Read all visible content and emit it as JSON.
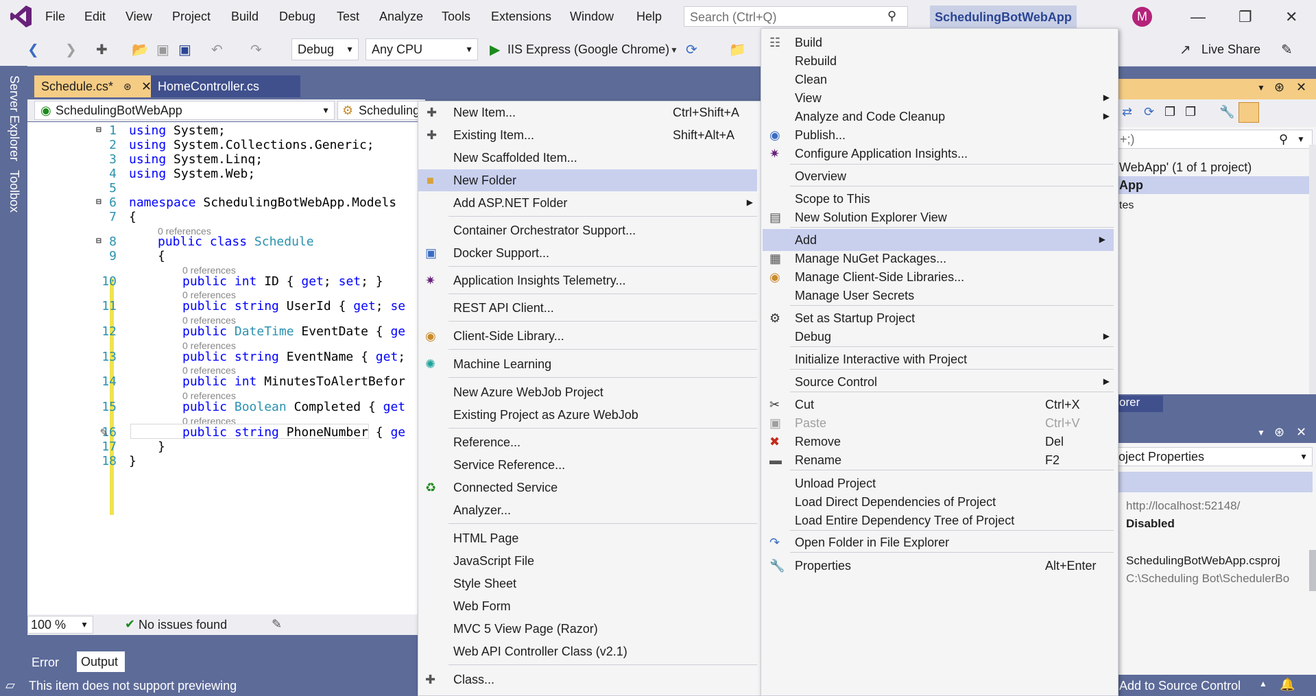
{
  "menubar": {
    "items": [
      "File",
      "Edit",
      "View",
      "Project",
      "Build",
      "Debug",
      "Test",
      "Analyze",
      "Tools",
      "Extensions",
      "Window",
      "Help"
    ],
    "search_placeholder": "Search (Ctrl+Q)",
    "solution_name": "SchedulingBotWebApp",
    "avatar_initial": "M"
  },
  "toolbar": {
    "config": "Debug",
    "platform": "Any CPU",
    "run_target": "IIS Express (Google Chrome)",
    "live_share": "Live Share"
  },
  "side": {
    "server_explorer": "Server Explorer",
    "toolbox": "Toolbox"
  },
  "editor": {
    "tabs": [
      {
        "label": "Schedule.cs*"
      },
      {
        "label": "HomeController.cs"
      }
    ],
    "nav_project": "SchedulingBotWebApp",
    "nav_class": "Scheduling",
    "line_numbers": [
      "1",
      "2",
      "3",
      "4",
      "5",
      "6",
      "7",
      "8",
      "9",
      "10",
      "11",
      "12",
      "13",
      "14",
      "15",
      "16",
      "17",
      "18"
    ],
    "ref_text": "0 references",
    "zoom": "100 %",
    "issues": "No issues found"
  },
  "bottom_tabs": [
    "Error List",
    "Output"
  ],
  "statusbar": {
    "message": "This item does not support previewing",
    "source_control": "Add to Source Control"
  },
  "right_panel": {
    "sol_title": "WebApp' (1 of 1 project)",
    "sol_project": "App",
    "sol_item": "tes",
    "explorer_tab": "orer",
    "prop_combo": "oject Properties",
    "prop_url": "http://localhost:52148/",
    "prop_ssl": "Disabled",
    "prop_file": "SchedulingBotWebApp.csproj",
    "prop_path": "C:\\Scheduling Bot\\SchedulerBo"
  },
  "add_menu": {
    "items": [
      {
        "label": "New Item...",
        "shortcut": "Ctrl+Shift+A",
        "icon": "new-item-icon"
      },
      {
        "label": "Existing Item...",
        "shortcut": "Shift+Alt+A",
        "icon": "existing-item-icon"
      },
      {
        "label": "New Scaffolded Item...",
        "shortcut": ""
      },
      {
        "label": "New Folder",
        "shortcut": "",
        "icon": "folder-icon"
      },
      {
        "label": "Add ASP.NET Folder",
        "shortcut": ""
      },
      {
        "label": "Container Orchestrator Support...",
        "shortcut": ""
      },
      {
        "label": "Docker Support...",
        "shortcut": "",
        "icon": "docker-icon"
      },
      {
        "label": "Application Insights Telemetry...",
        "shortcut": "",
        "icon": "insights-icon"
      },
      {
        "label": "REST API Client...",
        "shortcut": ""
      },
      {
        "label": "Client-Side Library...",
        "shortcut": "",
        "icon": "library-icon"
      },
      {
        "label": "Machine Learning",
        "shortcut": "",
        "icon": "ml-icon"
      },
      {
        "label": "New Azure WebJob Project",
        "shortcut": ""
      },
      {
        "label": "Existing Project as Azure WebJob",
        "shortcut": ""
      },
      {
        "label": "Reference...",
        "shortcut": ""
      },
      {
        "label": "Service Reference...",
        "shortcut": ""
      },
      {
        "label": "Connected Service",
        "shortcut": "",
        "icon": "connected-service-icon"
      },
      {
        "label": "Analyzer...",
        "shortcut": ""
      },
      {
        "label": "HTML Page",
        "shortcut": ""
      },
      {
        "label": "JavaScript File",
        "shortcut": ""
      },
      {
        "label": "Style Sheet",
        "shortcut": ""
      },
      {
        "label": "Web Form",
        "shortcut": ""
      },
      {
        "label": "MVC 5 View Page (Razor)",
        "shortcut": ""
      },
      {
        "label": "Web API Controller Class (v2.1)",
        "shortcut": ""
      },
      {
        "label": "Class...",
        "shortcut": "",
        "icon": "class-icon"
      }
    ]
  },
  "project_menu": {
    "items": [
      {
        "label": "Build",
        "shortcut": ""
      },
      {
        "label": "Rebuild",
        "shortcut": ""
      },
      {
        "label": "Clean",
        "shortcut": ""
      },
      {
        "label": "View",
        "shortcut": ""
      },
      {
        "label": "Analyze and Code Cleanup",
        "shortcut": ""
      },
      {
        "label": "Publish...",
        "shortcut": ""
      },
      {
        "label": "Configure Application Insights...",
        "shortcut": ""
      },
      {
        "label": "Overview",
        "shortcut": ""
      },
      {
        "label": "Scope to This",
        "shortcut": ""
      },
      {
        "label": "New Solution Explorer View",
        "shortcut": ""
      },
      {
        "label": "Add",
        "shortcut": ""
      },
      {
        "label": "Manage NuGet Packages...",
        "shortcut": ""
      },
      {
        "label": "Manage Client-Side Libraries...",
        "shortcut": ""
      },
      {
        "label": "Manage User Secrets",
        "shortcut": ""
      },
      {
        "label": "Set as Startup Project",
        "shortcut": ""
      },
      {
        "label": "Debug",
        "shortcut": ""
      },
      {
        "label": "Initialize Interactive with Project",
        "shortcut": ""
      },
      {
        "label": "Source Control",
        "shortcut": ""
      },
      {
        "label": "Cut",
        "shortcut": "Ctrl+X"
      },
      {
        "label": "Paste",
        "shortcut": "Ctrl+V"
      },
      {
        "label": "Remove",
        "shortcut": "Del"
      },
      {
        "label": "Rename",
        "shortcut": "F2"
      },
      {
        "label": "Unload Project",
        "shortcut": ""
      },
      {
        "label": "Load Direct Dependencies of Project",
        "shortcut": ""
      },
      {
        "label": "Load Entire Dependency Tree of Project",
        "shortcut": ""
      },
      {
        "label": "Open Folder in File Explorer",
        "shortcut": ""
      },
      {
        "label": "Properties",
        "shortcut": "Alt+Enter"
      }
    ]
  },
  "colors": {
    "accent": "#5d6b99",
    "highlight": "#c9d0ee",
    "panel_active": "#f5cc84"
  }
}
